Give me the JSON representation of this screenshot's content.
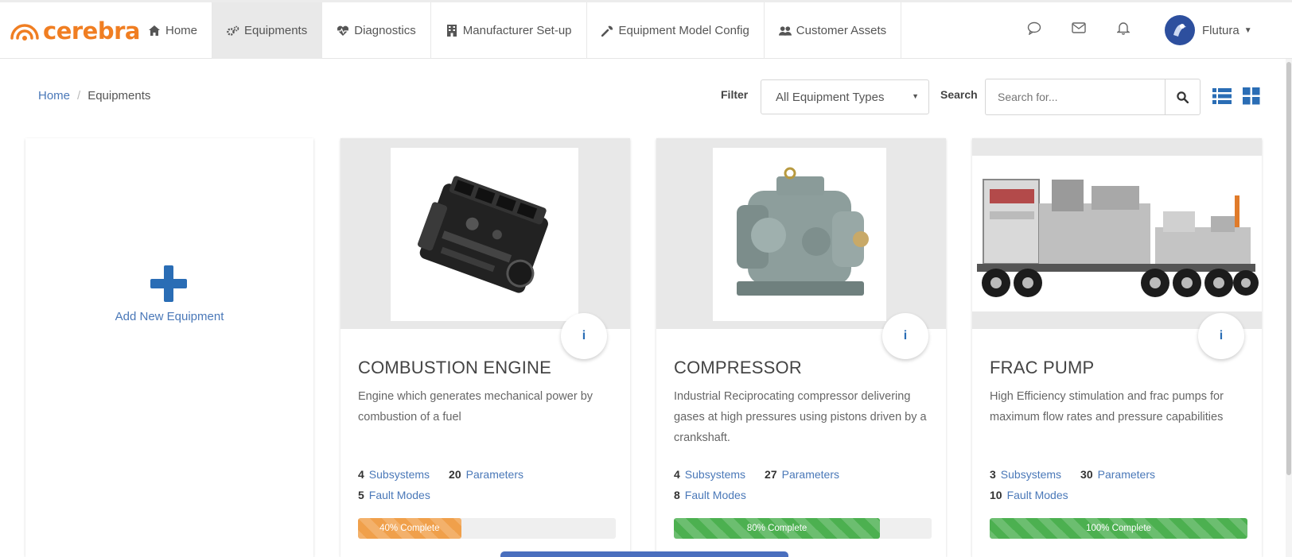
{
  "app": {
    "logo_text": "cerebra",
    "brand_color": "#f07e22",
    "accent_color": "#2a6db5"
  },
  "nav": {
    "items": [
      {
        "label": "Home",
        "icon": "home-icon",
        "active": false
      },
      {
        "label": "Equipments",
        "icon": "gears-icon",
        "active": true
      },
      {
        "label": "Diagnostics",
        "icon": "heartbeat-icon",
        "active": false
      },
      {
        "label": "Manufacturer Set-up",
        "icon": "building-icon",
        "active": false
      },
      {
        "label": "Equipment Model Config",
        "icon": "wrench-icon",
        "active": false
      },
      {
        "label": "Customer Assets",
        "icon": "users-icon",
        "active": false
      }
    ]
  },
  "user": {
    "name": "Flutura"
  },
  "breadcrumb": {
    "home": "Home",
    "current": "Equipments"
  },
  "toolbar": {
    "filter_label": "Filter",
    "filter_value": "All Equipment Types",
    "search_label": "Search",
    "search_placeholder": "Search for..."
  },
  "add_card": {
    "label": "Add New Equipment"
  },
  "equipments": [
    {
      "title": "COMBUSTION ENGINE",
      "description": "Engine which generates mechanical power by combustion of a fuel",
      "subsystems": "4",
      "subsystems_label": "Subsystems",
      "parameters": "20",
      "parameters_label": "Parameters",
      "fault_modes": "5",
      "fault_modes_label": "Fault Modes",
      "progress": 40,
      "progress_label": "40% Complete",
      "progress_color": "#f0a04b"
    },
    {
      "title": "COMPRESSOR",
      "description": "Industrial Reciprocating compressor delivering gases at high pressures using pistons driven by a crankshaft.",
      "subsystems": "4",
      "subsystems_label": "Subsystems",
      "parameters": "27",
      "parameters_label": "Parameters",
      "fault_modes": "8",
      "fault_modes_label": "Fault Modes",
      "progress": 80,
      "progress_label": "80% Complete",
      "progress_color": "#4cb050"
    },
    {
      "title": "FRAC PUMP",
      "description": "High Efficiency stimulation and frac pumps for maximum flow rates and pressure capabilities",
      "subsystems": "3",
      "subsystems_label": "Subsystems",
      "parameters": "30",
      "parameters_label": "Parameters",
      "fault_modes": "10",
      "fault_modes_label": "Fault Modes",
      "progress": 100,
      "progress_label": "100% Complete",
      "progress_color": "#4cb050"
    }
  ]
}
